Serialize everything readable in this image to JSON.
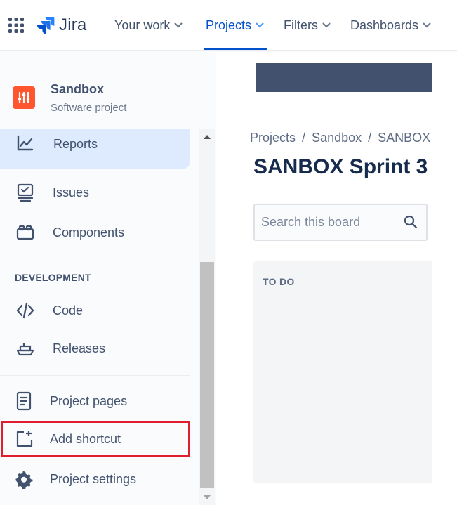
{
  "topnav": {
    "logo_text": "Jira",
    "items": [
      {
        "label": "Your work"
      },
      {
        "label": "Projects"
      },
      {
        "label": "Filters"
      },
      {
        "label": "Dashboards"
      }
    ]
  },
  "sidebar": {
    "project_name": "Sandbox",
    "project_type": "Software project",
    "items": [
      {
        "label": "Reports",
        "icon": "reports-icon"
      },
      {
        "label": "Issues",
        "icon": "issues-icon"
      },
      {
        "label": "Components",
        "icon": "components-icon"
      }
    ],
    "development_heading": "DEVELOPMENT",
    "dev_items": [
      {
        "label": "Code",
        "icon": "code-icon"
      },
      {
        "label": "Releases",
        "icon": "releases-icon"
      }
    ],
    "footer_items": [
      {
        "label": "Project pages",
        "icon": "page-icon"
      },
      {
        "label": "Add shortcut",
        "icon": "add-shortcut-icon"
      },
      {
        "label": "Project settings",
        "icon": "gear-icon"
      }
    ]
  },
  "main": {
    "breadcrumb": [
      "Projects",
      "Sandbox",
      "SANBOX"
    ],
    "breadcrumb_sep": "/",
    "title": "SANBOX Sprint 3",
    "search_placeholder": "Search this board",
    "column_title": "TO DO"
  },
  "colors": {
    "accent": "#0052cc",
    "highlight": "#e01e2e",
    "project_avatar": "#ff5630",
    "banner": "#42526e"
  }
}
